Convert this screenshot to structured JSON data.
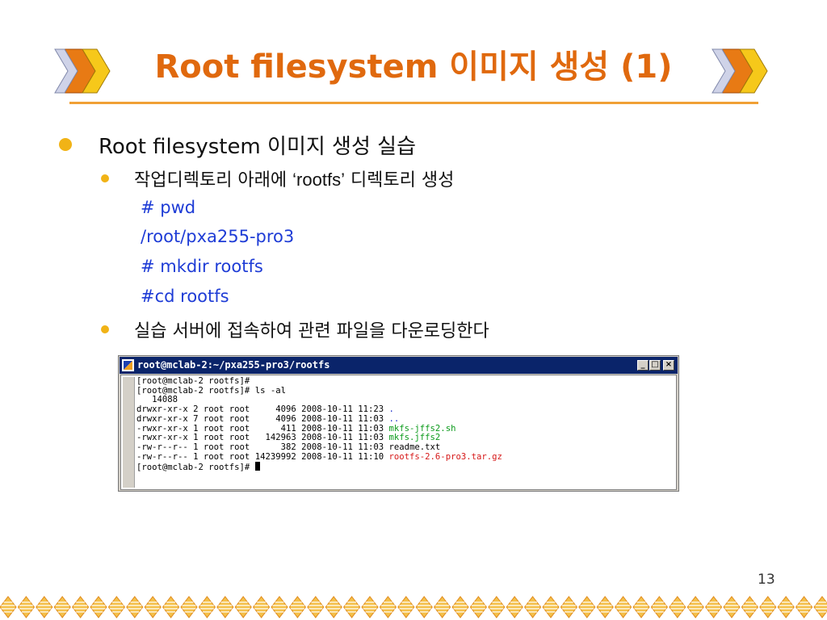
{
  "slide": {
    "title": "Root filesystem 이미지 생성 (1)",
    "page_number": "13",
    "accent_color": "#e0690e",
    "command_color": "#1e3cd6",
    "bullets": [
      {
        "level": 1,
        "text": "Root filesystem 이미지 생성 실습"
      },
      {
        "level": 2,
        "text_before": "작업디렉토리 아래에 ",
        "quoted": "‘rootfs’",
        "text_after": " 디렉토리 생성"
      },
      {
        "level": 2,
        "text": "실습 서버에 접속하여 관련 파일을 다운로딩한다"
      }
    ],
    "commands": [
      "# pwd",
      "/root/pxa255-pro3",
      "# mkdir rootfs",
      "#cd rootfs"
    ]
  },
  "terminal": {
    "title": "root@mclab-2:~/pxa255-pro3/rootfs",
    "buttons": [
      "_",
      "□",
      "×"
    ],
    "lines": {
      "prompt1": "[root@mclab-2 rootfs]#",
      "prompt2": "[root@mclab-2 rootfs]# ls -al",
      "total": "   14088",
      "prompt_end": "[root@mclab-2 rootfs]# "
    },
    "entries": [
      {
        "meta": "drwxr-xr-x 2 root root     4096 2008-10-11 11:23 ",
        "name": ".",
        "kind": "dir"
      },
      {
        "meta": "drwxr-xr-x 7 root root     4096 2008-10-11 11:03 ",
        "name": "..",
        "kind": "dir"
      },
      {
        "meta": "-rwxr-xr-x 1 root root      411 2008-10-11 11:03 ",
        "name": "mkfs-jffs2.sh",
        "kind": "exe"
      },
      {
        "meta": "-rwxr-xr-x 1 root root   142963 2008-10-11 11:03 ",
        "name": "mkfs.jffs2",
        "kind": "exe"
      },
      {
        "meta": "-rw-r--r-- 1 root root      382 2008-10-11 11:03 ",
        "name": "readme.txt",
        "kind": "txt"
      },
      {
        "meta": "-rw-r--r-- 1 root root 14239992 2008-10-11 11:10 ",
        "name": "rootfs-2.6-pro3.tar.gz",
        "kind": "arc"
      }
    ]
  }
}
